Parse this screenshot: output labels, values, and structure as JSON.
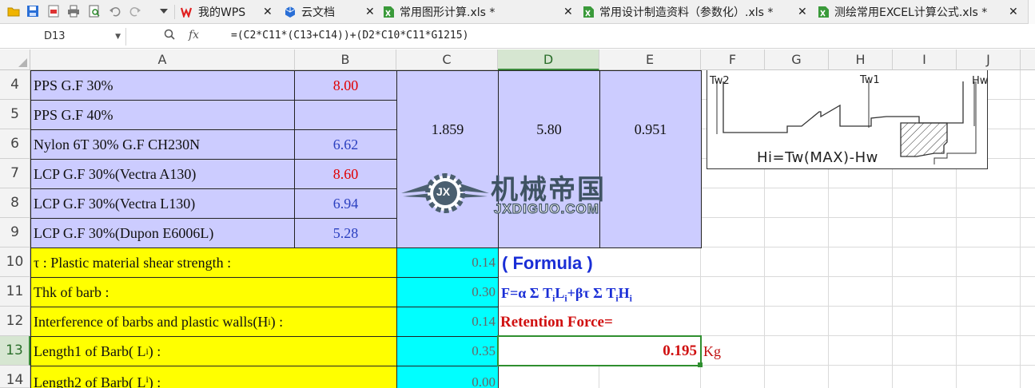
{
  "toolbar": {
    "icons": [
      "folder-icon",
      "save-icon",
      "export-pdf-icon",
      "print-icon",
      "print-preview-icon",
      "undo-icon",
      "redo-icon",
      "more-dropdown-icon"
    ]
  },
  "tabs": [
    {
      "label": "我的WPS",
      "icon": "wps-logo-icon"
    },
    {
      "label": "云文档",
      "icon": "cloud-doc-icon"
    },
    {
      "label": "常用图形计算.xls *",
      "icon": "spreadsheet-icon"
    },
    {
      "label": "常用设计制造资料（参数化）.xls *",
      "icon": "spreadsheet-icon"
    },
    {
      "label": "测绘常用EXCEL计算公式.xls *",
      "icon": "spreadsheet-icon"
    }
  ],
  "formula_bar": {
    "name_box": "D13",
    "fx": "fx",
    "formula": "=(C2*C11*(C13+C14))+(D2*C10*C11*G1215)"
  },
  "columns": [
    "A",
    "B",
    "C",
    "D",
    "E",
    "F",
    "G",
    "H",
    "I",
    "J"
  ],
  "rows": [
    "4",
    "5",
    "6",
    "7",
    "8",
    "9",
    "10",
    "11",
    "12",
    "13",
    "14"
  ],
  "materials": [
    {
      "name": "PPS G.F 30%",
      "value": "8.00",
      "color": "red"
    },
    {
      "name": "PPS G.F 40%",
      "value": "",
      "color": "blue"
    },
    {
      "name": "Nylon 6T 30% G.F CH230N",
      "value": "6.62",
      "color": "blue"
    },
    {
      "name": "LCP G.F 30%(Vectra A130)",
      "value": "8.60",
      "color": "red"
    },
    {
      "name": "LCP G.F 30%(Vectra L130)",
      "value": "6.94",
      "color": "blue"
    },
    {
      "name": "LCP G.F 30%(Dupon E6006L)",
      "value": "5.28",
      "color": "blue"
    }
  ],
  "merged": {
    "c": "1.859",
    "d": "5.80",
    "e": "0.951"
  },
  "params": [
    {
      "label": "τ : Plastic material shear strength :",
      "value": "0.14"
    },
    {
      "label": "Thk of barb :",
      "value": "0.30"
    },
    {
      "label_pre": "Interference of barbs and plastic walls(H",
      "label_sub": "i",
      "label_post": ") :",
      "value": "0.14"
    },
    {
      "label_pre": "Length1 of Barb( L",
      "label_sub": "i",
      "label_post": " ) :",
      "value": "0.35"
    },
    {
      "label_pre": "Length2 of Barb( L",
      "label_sub": "i",
      "label_post": " ) :",
      "value": "0.00"
    }
  ],
  "formula_block": {
    "title": "( Formula )",
    "f_pre": "F=α Σ T",
    "f_s1": "i",
    "f_mid1": "L",
    "f_s2": "i",
    "f_mid2": "+βτ Σ T",
    "f_s3": "i",
    "f_mid3": "H",
    "f_s4": "i",
    "retention_label": "Retention Force=",
    "result": "0.195",
    "unit": "Kg"
  },
  "diagram": {
    "labels": [
      "Tw2",
      "Tw1",
      "Hw"
    ],
    "equation": "Hi=Tw(MAX)-Hw"
  },
  "watermark": {
    "text_cn": "机械帝国",
    "text_en": "JXDIGUO.COM",
    "badge": "JX"
  }
}
